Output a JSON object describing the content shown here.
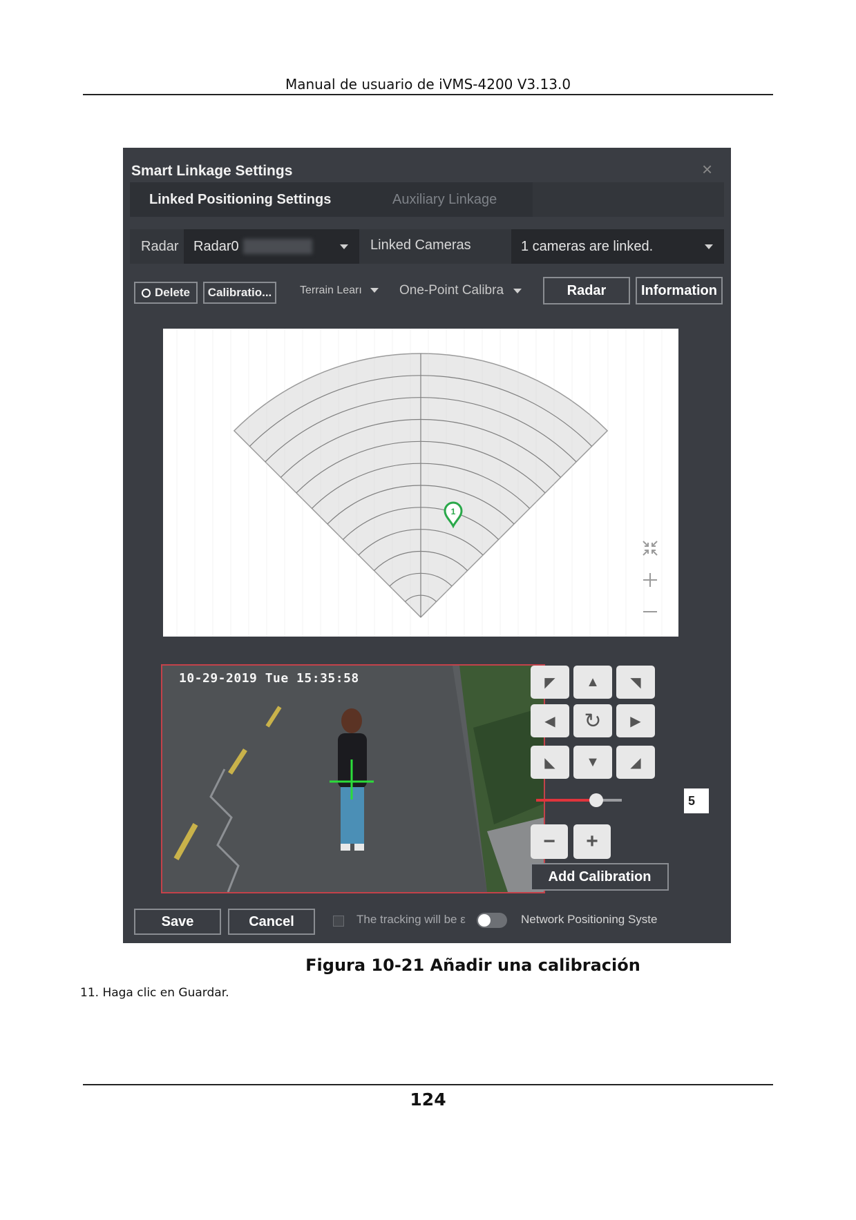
{
  "page": {
    "header": "Manual de usuario de iVMS-4200 V3.13.0",
    "caption": "Figura 10-21 Añadir una calibración",
    "step": "11. Haga clic en Guardar.",
    "page_number": "124"
  },
  "dialog": {
    "title": "Smart Linkage Settings",
    "close_glyph": "×",
    "tabs": {
      "linked": "Linked Positioning Settings",
      "auxiliary": "Auxiliary Linkage"
    },
    "radar_label": "Radar",
    "radar_value": "Radar0",
    "linked_cameras_label": "Linked Cameras",
    "linked_cameras_value": "1 cameras are linked.",
    "toolbar": {
      "delete": "Delete",
      "calibration": "Calibratio...",
      "terrain": "Terrain Learı",
      "one_point": "One-Point Calibra",
      "radar": "Radar",
      "information": "Information"
    },
    "marker_label": "1",
    "timestamp": "10-29-2019 Tue 15:35:58",
    "speed_value": "5",
    "speed_fraction": 0.7,
    "add_calibration": "Add Calibration",
    "save": "Save",
    "cancel": "Cancel",
    "tracking_text": "The tracking will be ε",
    "network_text": "Network Positioning Syste"
  },
  "colors": {
    "dialog_bg": "#3a3d43",
    "marker": "#2aa84a",
    "slider": "#e0343c",
    "video_border": "#c4424a"
  },
  "icons": [
    "close-icon",
    "caret-down-icon",
    "delete-circle-icon",
    "collapse-icon",
    "zoom-in-icon",
    "zoom-out-icon",
    "ptz-arrow-icons",
    "refresh-icon",
    "minus-icon",
    "plus-icon",
    "location-marker-icon",
    "toggle-switch-icon",
    "checkbox-icon"
  ]
}
